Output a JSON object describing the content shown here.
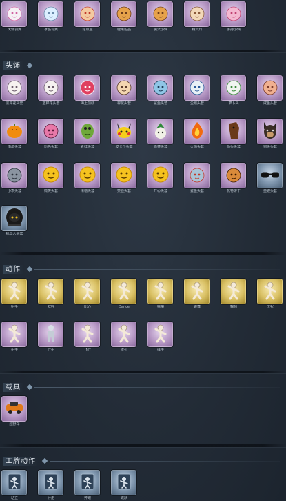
{
  "sections": [
    {
      "id": "top",
      "title": "",
      "items": [
        {
          "label": "天使羽翼",
          "rarity": "purple",
          "icon": "angel-wings-icon"
        },
        {
          "label": "冰晶羽翼",
          "rarity": "purple",
          "icon": "ice-wings-icon"
        },
        {
          "label": "甜点屋",
          "rarity": "purple",
          "icon": "doll-icon"
        },
        {
          "label": "糖果甜品",
          "rarity": "purple",
          "icon": "figure-icon"
        },
        {
          "label": "魔法小偶",
          "rarity": "purple",
          "icon": "figure-icon"
        },
        {
          "label": "精灵灯",
          "rarity": "purple",
          "icon": "lantern-icon"
        },
        {
          "label": "手持小偶",
          "rarity": "purple",
          "icon": "pink-doll-icon"
        }
      ]
    },
    {
      "id": "headwear",
      "title": "头饰",
      "items": [
        {
          "label": "黑棉花头套",
          "rarity": "purple",
          "icon": "cotton-head-icon"
        },
        {
          "label": "蓝棉花头套",
          "rarity": "purple",
          "icon": "cotton-head-icon"
        },
        {
          "label": "海上前线",
          "rarity": "purple",
          "icon": "pink-bird-icon"
        },
        {
          "label": "棉花头套",
          "rarity": "purple",
          "icon": "face-head-icon"
        },
        {
          "label": "鲨鱼头套",
          "rarity": "purple",
          "icon": "shark-head-icon"
        },
        {
          "label": "企鹅头套",
          "rarity": "purple",
          "icon": "penguin-head-icon"
        },
        {
          "label": "萝卜头",
          "rarity": "purple",
          "icon": "radish-head-icon"
        },
        {
          "label": "咸鱼头套",
          "rarity": "purple",
          "icon": "cake-head-icon"
        },
        {
          "label": "南瓜头套",
          "rarity": "purple",
          "icon": "pumpkin-head-icon"
        },
        {
          "label": "粉色头套",
          "rarity": "purple",
          "icon": "pink-ball-icon"
        },
        {
          "label": "青蛙头套",
          "rarity": "purple",
          "icon": "frog-head-icon"
        },
        {
          "label": "皮卡丘头套",
          "rarity": "purple",
          "icon": "pikachu-head-icon"
        },
        {
          "label": "白菜头套",
          "rarity": "purple",
          "icon": "cabbage-head-icon"
        },
        {
          "label": "火焰头套",
          "rarity": "purple",
          "icon": "flame-head-icon"
        },
        {
          "label": "马头头套",
          "rarity": "purple",
          "icon": "horse-head-icon"
        },
        {
          "label": "狗头头套",
          "rarity": "purple",
          "icon": "dog-head-icon"
        },
        {
          "label": "小乖头套",
          "rarity": "purple",
          "icon": "grey-ball-icon"
        },
        {
          "label": "微笑头套",
          "rarity": "purple",
          "icon": "smile-icon"
        },
        {
          "label": "滑稽头套",
          "rarity": "purple",
          "icon": "smile-icon"
        },
        {
          "label": "笑脸头套",
          "rarity": "purple",
          "icon": "smile-icon"
        },
        {
          "label": "开心头套",
          "rarity": "purple",
          "icon": "smile-icon"
        },
        {
          "label": "鲨鱼头套",
          "rarity": "purple",
          "icon": "shark-fish-icon"
        },
        {
          "label": "瓦特饼干",
          "rarity": "purple",
          "icon": "cookie-head-icon"
        },
        {
          "label": "墨镜头套",
          "rarity": "blue",
          "icon": "sunglasses-icon"
        },
        {
          "label": "机器人头套",
          "rarity": "blue",
          "icon": "robot-head-icon"
        }
      ]
    },
    {
      "id": "actions",
      "title": "动作",
      "items": [
        {
          "label": "招手",
          "rarity": "gold",
          "icon": "pose-icon"
        },
        {
          "label": "欢呼",
          "rarity": "gold",
          "icon": "pose-icon"
        },
        {
          "label": "比心",
          "rarity": "gold",
          "icon": "pose-icon"
        },
        {
          "label": "Dance",
          "rarity": "gold",
          "icon": "pose-icon"
        },
        {
          "label": "摇摆",
          "rarity": "gold",
          "icon": "pose-icon"
        },
        {
          "label": "跳舞",
          "rarity": "gold",
          "icon": "pose-icon"
        },
        {
          "label": "鞠躬",
          "rarity": "gold",
          "icon": "pose-icon"
        },
        {
          "label": "庆祝",
          "rarity": "gold",
          "icon": "pose-icon"
        },
        {
          "label": "拍手",
          "rarity": "purple",
          "icon": "pose-icon"
        },
        {
          "label": "守护",
          "rarity": "purple",
          "icon": "silver-figure-icon"
        },
        {
          "label": "飞行",
          "rarity": "purple",
          "icon": "pose-icon"
        },
        {
          "label": "敬礼",
          "rarity": "purple",
          "icon": "pose-icon"
        },
        {
          "label": "挥手",
          "rarity": "purple",
          "icon": "pose-icon"
        }
      ]
    },
    {
      "id": "vehicle",
      "title": "载具",
      "items": [
        {
          "label": "越野车",
          "rarity": "purple",
          "icon": "car-icon"
        }
      ]
    },
    {
      "id": "badge-actions",
      "title": "工牌动作",
      "items": [
        {
          "label": "站立",
          "rarity": "blue",
          "icon": "badge-figure-icon"
        },
        {
          "label": "行走",
          "rarity": "blue",
          "icon": "badge-figure-icon"
        },
        {
          "label": "奔跑",
          "rarity": "blue",
          "icon": "badge-figure-icon"
        },
        {
          "label": "跳跃",
          "rarity": "blue",
          "icon": "badge-figure-icon"
        }
      ]
    }
  ]
}
